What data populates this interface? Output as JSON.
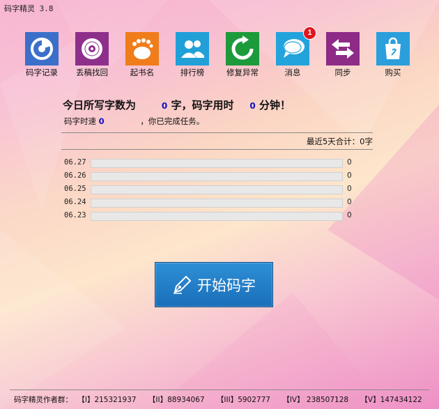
{
  "window": {
    "title": "码字精灵 3.8"
  },
  "toolbar": [
    {
      "label": "码字记录",
      "icon": "chart-pie-icon",
      "color": "#3b6fc9",
      "badge": ""
    },
    {
      "label": "丢稿找回",
      "icon": "disc-icon",
      "color": "#8e2f8c",
      "badge": ""
    },
    {
      "label": "起书名",
      "icon": "footprint-icon",
      "color": "#f07d1b",
      "badge": ""
    },
    {
      "label": "排行榜",
      "icon": "users-icon",
      "color": "#21a0d8",
      "badge": ""
    },
    {
      "label": "修复异常",
      "icon": "refresh-icon",
      "color": "#1d9a3b",
      "badge": ""
    },
    {
      "label": "消息",
      "icon": "chat-bubbles-icon",
      "color": "#23a3dc",
      "badge": "1"
    },
    {
      "label": "同步",
      "icon": "sync-arrows-icon",
      "color": "#8d2b87",
      "badge": ""
    },
    {
      "label": "购买",
      "icon": "shopping-bag-icon",
      "color": "#2a9fdb",
      "badge": ""
    }
  ],
  "summary": {
    "prefix": "今日所写字数为",
    "words": "0",
    "mid": "字，码字用时",
    "minutes": "0",
    "suffix": "分钟！"
  },
  "speed": {
    "label": "码字时速",
    "value": "0",
    "note": "，你已完成任务。"
  },
  "recent": {
    "label": "最近5天合计：0字"
  },
  "history": [
    {
      "date": "06.27",
      "count": "0",
      "progress": 0
    },
    {
      "date": "06.26",
      "count": "0",
      "progress": 0
    },
    {
      "date": "06.25",
      "count": "0",
      "progress": 0
    },
    {
      "date": "06.24",
      "count": "0",
      "progress": 0
    },
    {
      "date": "06.23",
      "count": "0",
      "progress": 0
    }
  ],
  "start_button": {
    "label": "开始码字",
    "icon": "pen-nib-icon"
  },
  "footer": {
    "label": "码字精灵作者群：",
    "groups": [
      "【I】215321937",
      "【II】88934067",
      "【III】5902777",
      "【IV】 238507128",
      "【V】147434122"
    ]
  },
  "colors": {
    "accent": "#1a6fb9",
    "number": "#1010c0",
    "badge": "#e0161d"
  }
}
